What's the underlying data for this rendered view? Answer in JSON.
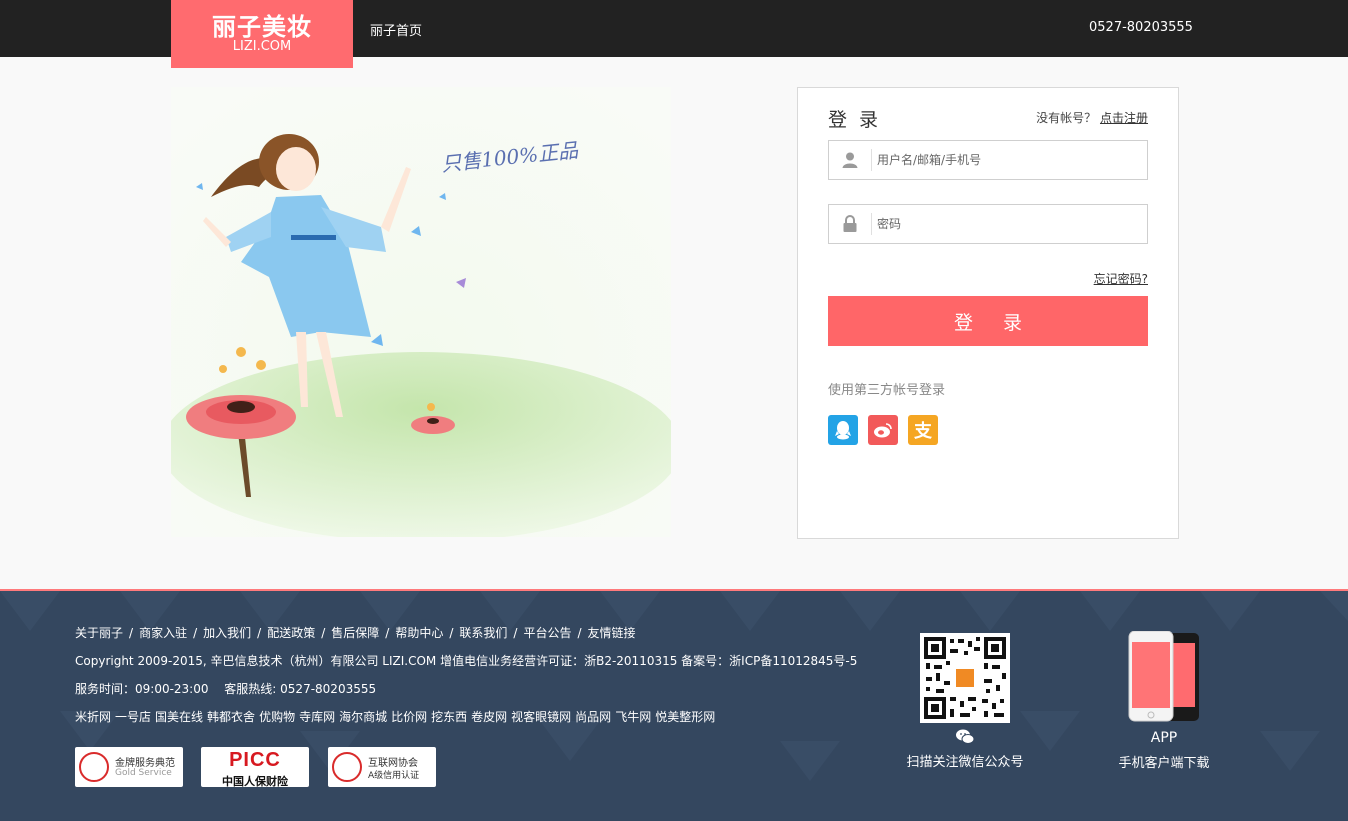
{
  "header": {
    "logo_cn": "丽子美妆",
    "logo_en": "LIZI.COM",
    "nav_home": "丽子首页",
    "phone": "0527-80203555"
  },
  "illustration": {
    "slogan": "只售100%正品"
  },
  "login": {
    "title": "登 录",
    "no_account": "没有帐号？",
    "register_link": "点击注册",
    "username_placeholder": "用户名/邮箱/手机号",
    "password_placeholder": "密码",
    "forgot": "忘记密码?",
    "submit": "登 录",
    "third_party_label": "使用第三方帐号登录",
    "social_icons": [
      "qq-icon",
      "weibo-icon",
      "alipay-icon"
    ],
    "alipay_glyph": "支"
  },
  "footer": {
    "links": [
      "关于丽子",
      "商家入驻",
      "加入我们",
      "配送政策",
      "售后保障",
      "帮助中心",
      "联系我们",
      "平台公告",
      "友情链接"
    ],
    "link_separator": "/",
    "copyright": "Copyright 2009-2015, 辛巴信息技术（杭州）有限公司 LIZI.COM 增值电信业务经营许可证：浙B2-20110315 备案号：浙ICP备11012845号-5",
    "hours": "服务时间：09:00-23:00　 客服热线: 0527-80203555",
    "partners": [
      "米折网",
      "一号店",
      "国美在线",
      "韩都衣舍",
      "优购物",
      "寺库网",
      "海尔商城",
      "比价网",
      "挖东西",
      "卷皮网",
      "视客眼镜网",
      "尚品网",
      "飞牛网",
      "悦美整形网"
    ],
    "badges": {
      "gold_title": "金牌服务典范",
      "gold_sub": "Gold Service",
      "picc_main": "PICC",
      "picc_sub": "中国人保财险",
      "internet_title": "互联网协会",
      "internet_sub": "A级信用认证"
    },
    "qr_label": "扫描关注微信公众号",
    "app_title": "APP",
    "app_label": "手机客户端下载"
  },
  "colors": {
    "brand": "#ff6b6f",
    "topbar": "#222222",
    "footer_bg": "#34475f",
    "qq": "#23a3e6",
    "weibo": "#f25a5a",
    "alipay": "#f5a623"
  }
}
